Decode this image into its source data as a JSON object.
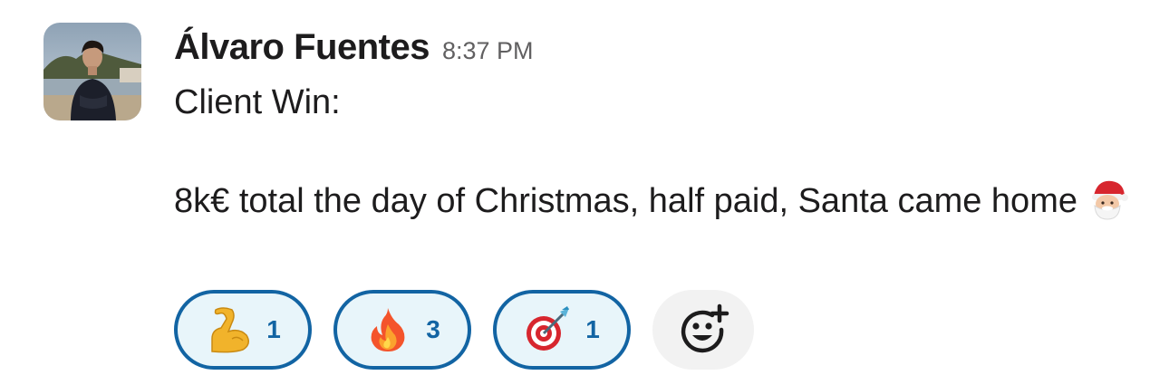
{
  "message": {
    "author": "Álvaro Fuentes",
    "timestamp": "8:37 PM",
    "lines": [
      "Client Win:",
      "8k€ total the day of Christmas, half paid, Santa came home"
    ],
    "inline_emoji": "santa-emoji"
  },
  "reactions": [
    {
      "emoji": "flexed-biceps-emoji",
      "count": "1",
      "selected": true
    },
    {
      "emoji": "fire-emoji",
      "count": "3",
      "selected": true
    },
    {
      "emoji": "direct-hit-emoji",
      "count": "1",
      "selected": true
    }
  ],
  "add_reaction": {
    "icon": "add-reaction-icon"
  },
  "colors": {
    "accent": "#1264a3",
    "reaction_bg": "#e8f5fa",
    "text": "#1d1c1d",
    "muted": "#616061"
  }
}
